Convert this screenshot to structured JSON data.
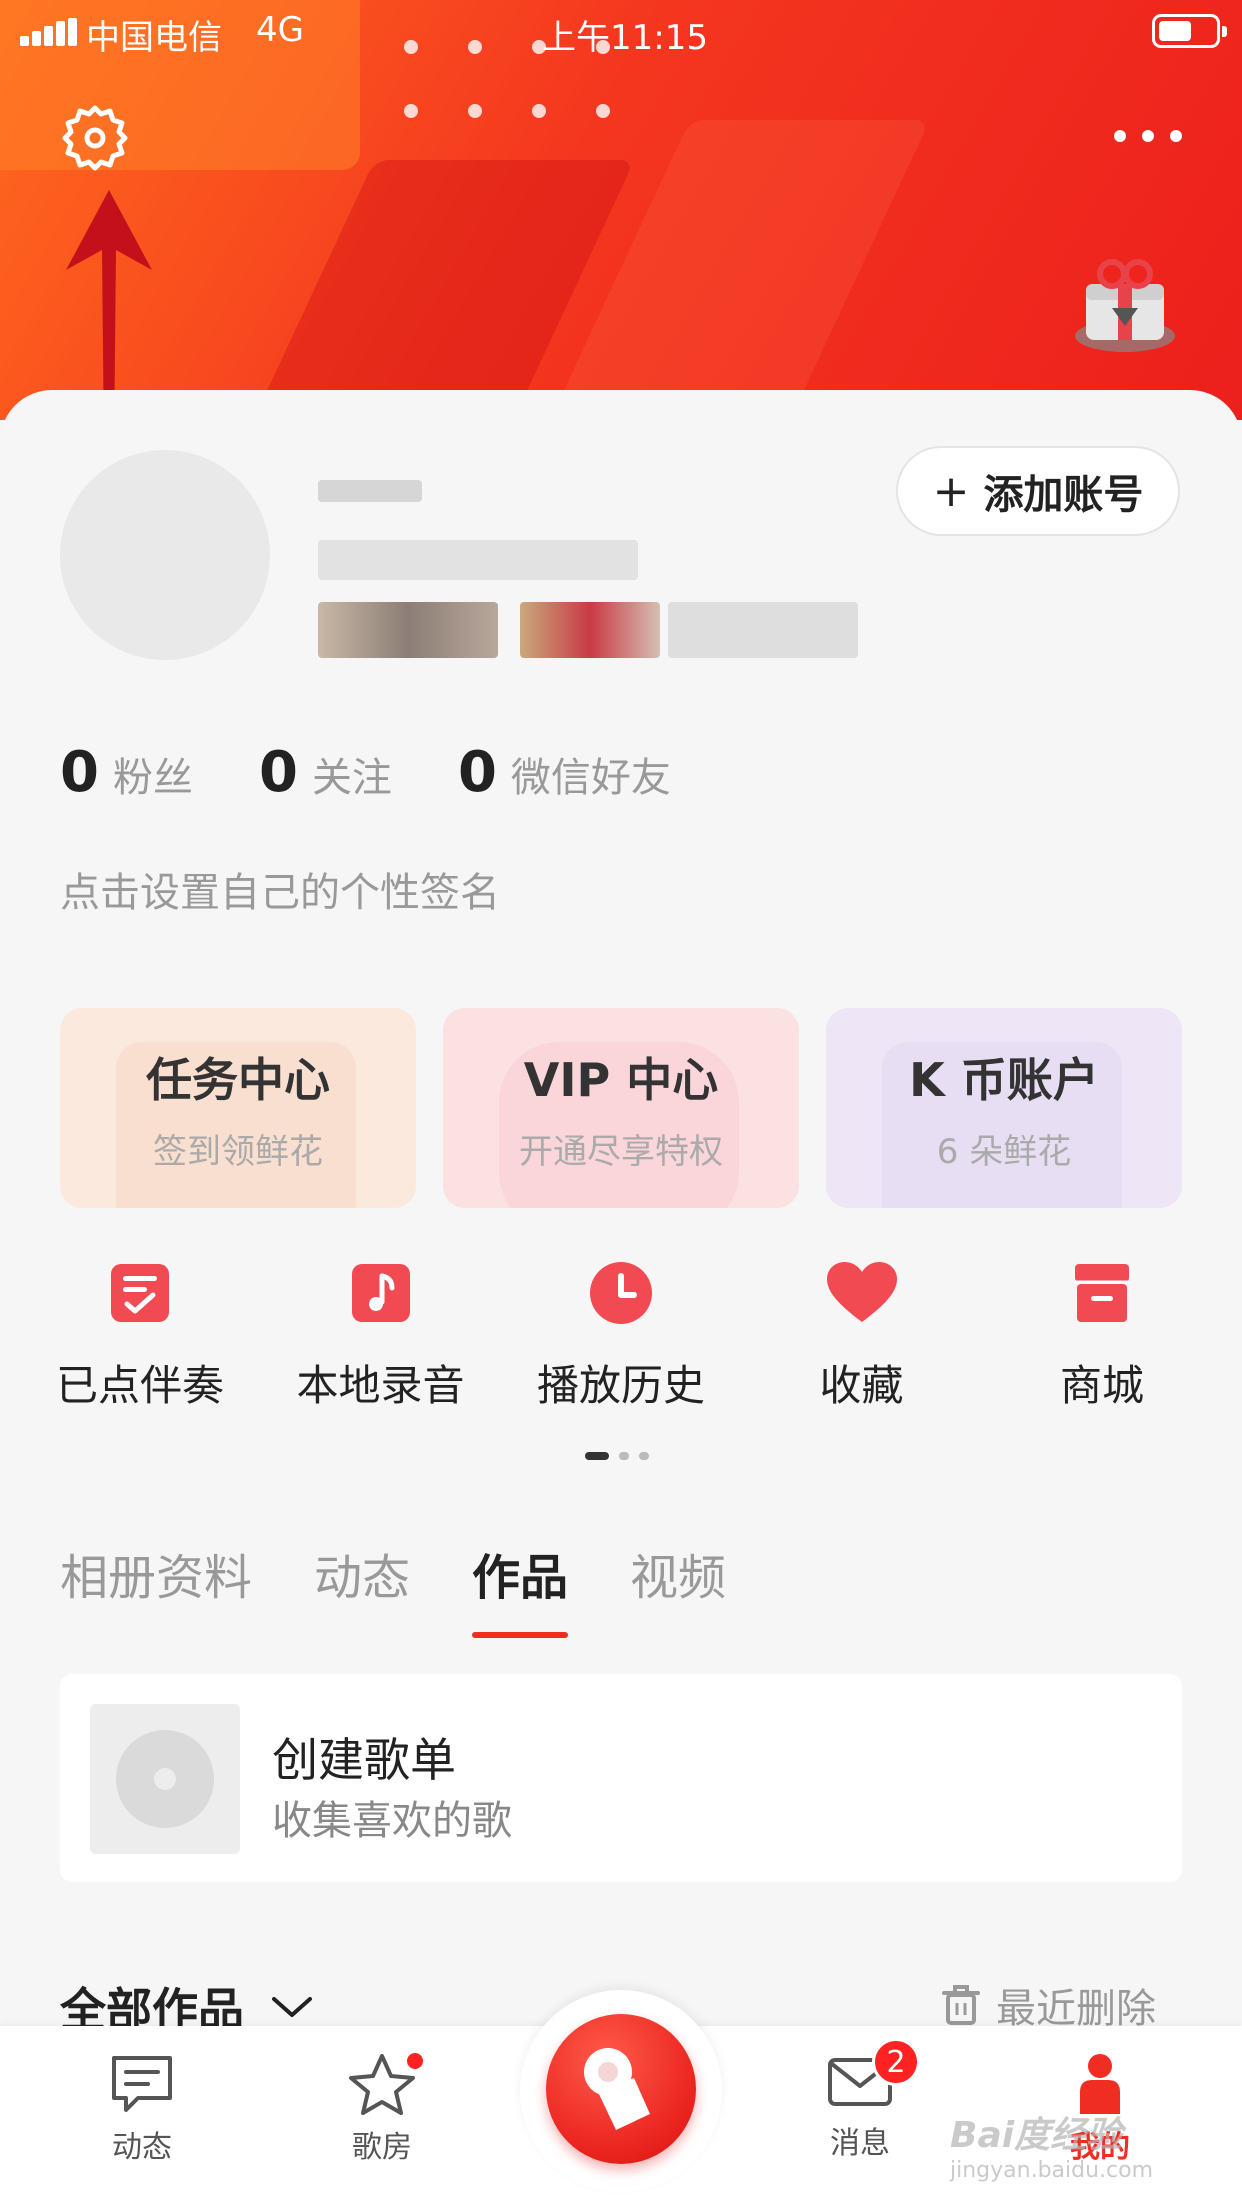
{
  "status_bar": {
    "carrier": "中国电信",
    "network": "4G",
    "time": "上午11:15"
  },
  "profile": {
    "add_account_label": "添加账号",
    "stats": [
      {
        "value": "0",
        "label": "粉丝"
      },
      {
        "value": "0",
        "label": "关注"
      },
      {
        "value": "0",
        "label": "微信好友"
      }
    ],
    "signature_placeholder": "点击设置自己的个性签名"
  },
  "features": [
    {
      "title": "任务中心",
      "subtitle": "签到领鲜花"
    },
    {
      "title": "VIP 中心",
      "subtitle": "开通尽享特权"
    },
    {
      "title": "K 币账户",
      "subtitle": "6 朵鲜花"
    }
  ],
  "quick_actions": [
    {
      "label": "已点伴奏",
      "icon": "checklist-icon"
    },
    {
      "label": "本地录音",
      "icon": "music-note-icon"
    },
    {
      "label": "播放历史",
      "icon": "clock-icon"
    },
    {
      "label": "收藏",
      "icon": "heart-icon"
    },
    {
      "label": "商城",
      "icon": "store-icon"
    }
  ],
  "content_tabs": [
    {
      "label": "相册资料",
      "active": false
    },
    {
      "label": "动态",
      "active": false
    },
    {
      "label": "作品",
      "active": true
    },
    {
      "label": "视频",
      "active": false
    }
  ],
  "playlist_card": {
    "title": "创建歌单",
    "subtitle": "收集喜欢的歌"
  },
  "works_section": {
    "filter_label": "全部作品",
    "recent_delete_label": "最近删除"
  },
  "tabbar": {
    "items": [
      {
        "label": "动态",
        "icon": "feed-icon"
      },
      {
        "label": "歌房",
        "icon": "star-icon"
      },
      {
        "label": "消息",
        "icon": "mail-icon",
        "badge": "2"
      },
      {
        "label": "我的",
        "icon": "person-icon"
      }
    ]
  },
  "watermark": {
    "text": "Bai度经验",
    "url_text": "jingyan.baidu.com"
  },
  "colors": {
    "accent": "#ef2d23",
    "header_start": "#ff6a1e",
    "header_end": "#ec1f1c"
  }
}
